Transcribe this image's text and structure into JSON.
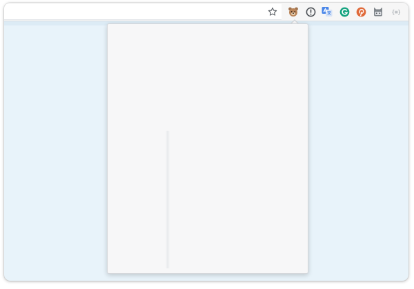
{
  "toolbar": {
    "icons": [
      {
        "name": "bookmark-star-icon",
        "color": "#5f6368"
      },
      {
        "name": "bear-extension-icon",
        "color": "#a0734e"
      },
      {
        "name": "info-extension-icon",
        "color": "#4d5156"
      },
      {
        "name": "translate-extension-icon",
        "color": "#4a86e8"
      },
      {
        "name": "grammarly-extension-icon",
        "color": "#15a37f"
      },
      {
        "name": "pinterest-extension-icon",
        "color": "#e06a3a"
      },
      {
        "name": "cat-extension-icon",
        "color": "#80868b"
      },
      {
        "name": "json-extension-icon",
        "color": "#9aa0a6"
      }
    ],
    "json_label": "{≡}"
  },
  "colors": {
    "page_background": "#e8f3fa",
    "popup_background": "#f7f7f8",
    "toolbar_background": "#f6f6f6"
  }
}
